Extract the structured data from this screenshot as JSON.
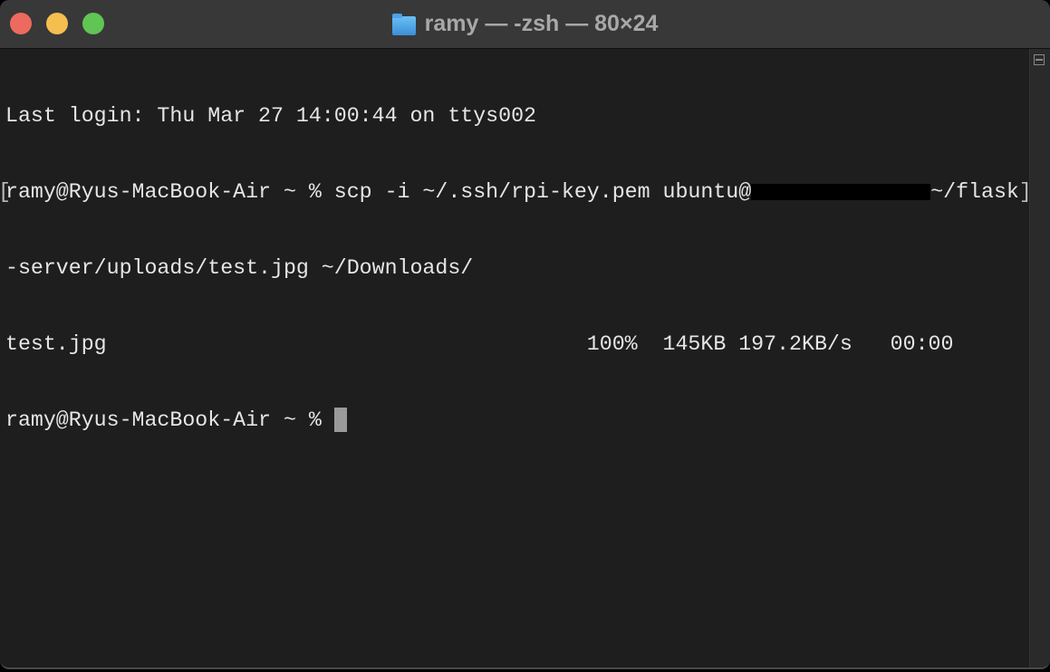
{
  "window": {
    "title": "ramy — -zsh — 80×24",
    "title_icon": "folder-icon"
  },
  "terminal": {
    "lines": [
      "Last login: Thu Mar 27 14:00:44 on ttys002",
      "ramy@Ryus-MacBook-Air ~ % scp -i ~/.ssh/rpi-key.pem ubuntu@",
      "~/flask",
      "-server/uploads/test.jpg ~/Downloads/",
      "test.jpg                                      100%  145KB 197.2KB/s   00:00",
      "ramy@Ryus-MacBook-Air ~ % "
    ],
    "mark_open": "[",
    "mark_close": "]"
  }
}
